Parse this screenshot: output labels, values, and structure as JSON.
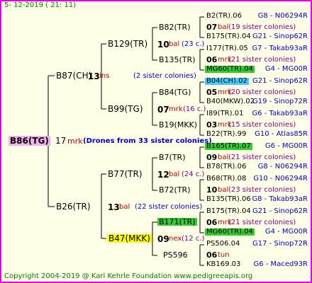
{
  "header": {
    "date": "5- 12-2019 ( 21: 11)"
  },
  "footer": {
    "copyright": "Copyright 2004-2019 @ Karl Kehrle Foundation    www.pedigreeapis.org"
  },
  "colors": {
    "frame": "#e800e8",
    "root_bg": "#f0b0f0",
    "green": "#33cc33",
    "cyan": "#44ccff",
    "yellow": "#ffff00",
    "line": "#000000"
  },
  "root": {
    "label": "B86(TG)",
    "num": "17",
    "race": "mrk",
    "note": "(Drones from 33 sister colonies)"
  },
  "gen1": [
    {
      "label": "B87(CH)",
      "num": "13",
      "race": "ins",
      "note": "(2 sister colonies)"
    },
    {
      "label": "B26(TR)",
      "num": "13",
      "race": "bal",
      "note": "(22 sister colonies)"
    }
  ],
  "gen2": [
    {
      "label": "B129(TR)",
      "num": "10",
      "race": "bal",
      "note": "(23 c.)"
    },
    {
      "label": "B99(TG)",
      "num": "07",
      "race": "mrk",
      "note": "(16 c.)"
    },
    {
      "label": "B77(TR)",
      "num": "12",
      "race": "bal",
      "note": "(24 c.)"
    },
    {
      "label": "B47(MKK)",
      "num": "09",
      "race": "nex",
      "note": "(12 c.)"
    }
  ],
  "gen3": [
    {
      "label": "B82(TR)"
    },
    {
      "label": "B135(TR)"
    },
    {
      "label": "B84(TG)"
    },
    {
      "label": "B19(MKK)"
    },
    {
      "label": "B7(TR)"
    },
    {
      "label": "B72(TR)"
    },
    {
      "label": "B171(TR)"
    },
    {
      "label": "PS596"
    }
  ],
  "gen3_mid": [
    {
      "num": "07",
      "race": "bal",
      "note": "(19 sister colonies)"
    },
    {
      "num": "06",
      "race": "mrk",
      "note": "(21 sister colonies)"
    },
    {
      "num": "05",
      "race": "mrk",
      "note": "(20 sister colonies)"
    },
    {
      "num": "03",
      "race": "mrk",
      "note": "(15 sister colonies)"
    },
    {
      "num": "09",
      "race": "bal",
      "note": "(21 sister colonies)"
    },
    {
      "num": "10",
      "race": "bal",
      "note": "(23 sister colonies)"
    },
    {
      "num": "06",
      "race": "mrk",
      "note": "(21 sister colonies)"
    },
    {
      "num": "06",
      "race": "tun",
      "note": ""
    }
  ],
  "gen4": [
    {
      "label": "B2(TR).06",
      "info": "G8 - N06294R"
    },
    {
      "label": "B175(TR).04",
      "info": "G21 - Sinop62R"
    },
    {
      "label": "I177(TR).05",
      "info": "G7 - Takab93aR"
    },
    {
      "label": "MG60(TR).04",
      "info": "G4 - MG00R"
    },
    {
      "label": "B04(CH).02",
      "info": "G21 - Sinop62R"
    },
    {
      "label": "B40(MKW).02",
      "info": "G19 - Sinop72R"
    },
    {
      "label": "I89(TR).01",
      "info": "G6 - Takab93aR"
    },
    {
      "label": "B22(TR).99",
      "info": "G10 - Atlas85R"
    },
    {
      "label": "B165(TR).07",
      "info": "G6 - MG00R"
    },
    {
      "label": "B78(TR).06",
      "info": "G8 - N06294R"
    },
    {
      "label": "B68(TR).08",
      "info": "G10 - N06294R"
    },
    {
      "label": "B135(TR).06",
      "info": "G8 - Takab93aR"
    },
    {
      "label": "B175(TR).04",
      "info": "G21 - Sinop62R"
    },
    {
      "label": "MG60(TR).04",
      "info": "G4 - MG00R"
    },
    {
      "label": "PS506.04",
      "info": "G17 - Sinop72R"
    },
    {
      "label": "KB169.03",
      "info": "G6 - Maced93R"
    }
  ]
}
